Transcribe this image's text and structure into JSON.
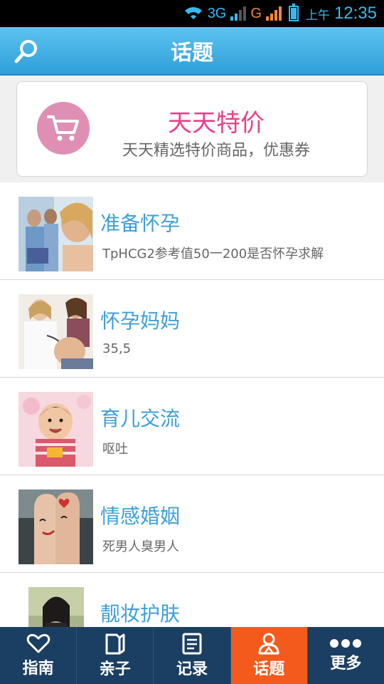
{
  "status_bar": {
    "network1": "3G",
    "network2": "G",
    "ampm": "上午",
    "time": "12:35"
  },
  "header": {
    "title": "话题"
  },
  "promo": {
    "title": "天天特价",
    "subtitle": "天天精选特价商品，优惠券"
  },
  "topics": [
    {
      "title": "准备怀孕",
      "latest": "TpHCG2参考值50一200是否怀孕求解"
    },
    {
      "title": "怀孕妈妈",
      "latest": "35,5"
    },
    {
      "title": "育儿交流",
      "latest": "呕吐"
    },
    {
      "title": "情感婚姻",
      "latest": "死男人臭男人"
    },
    {
      "title": "靓妆护肤",
      "latest": ""
    }
  ],
  "bottom_nav": [
    {
      "label": "指南",
      "icon": "heart-icon"
    },
    {
      "label": "亲子",
      "icon": "book-icon"
    },
    {
      "label": "记录",
      "icon": "notes-icon"
    },
    {
      "label": "话题",
      "icon": "people-icon",
      "active": true
    },
    {
      "label": "更多",
      "icon": "more-dots-icon"
    }
  ],
  "colors": {
    "header_blue": "#3fb0e6",
    "promo_pink": "#e8418a",
    "topic_blue": "#3d9fd6",
    "nav_bg": "#1b3f62",
    "nav_active": "#f35a1c"
  }
}
